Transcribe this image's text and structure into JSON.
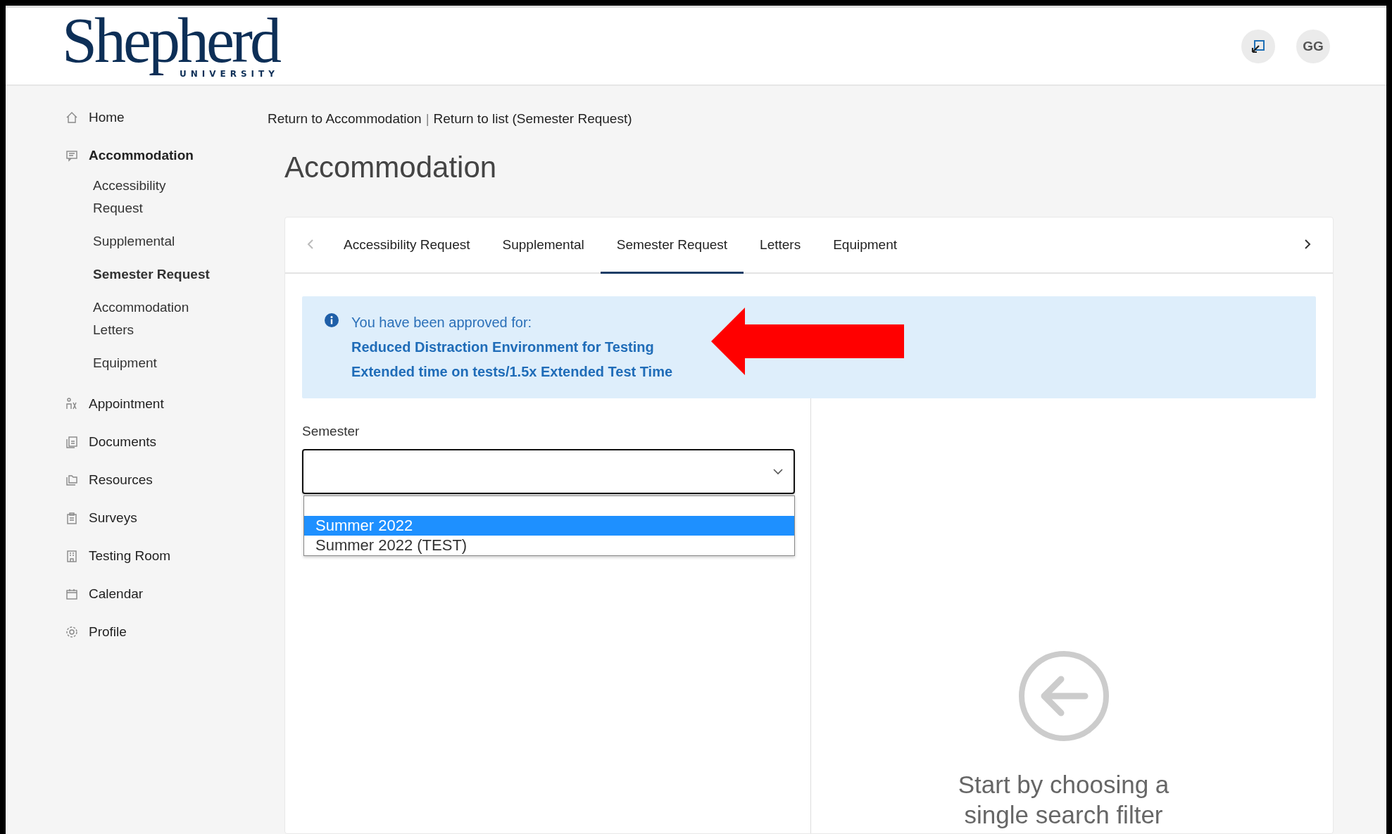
{
  "header": {
    "logo": {
      "name": "Shepherd",
      "subtitle": "UNIVERSITY"
    },
    "avatar": "GG"
  },
  "sidebar": {
    "items": [
      {
        "label": "Home",
        "selected": false
      },
      {
        "label": "Accommodation",
        "selected": true,
        "children": [
          {
            "label": "Accessibility Request",
            "selected": false
          },
          {
            "label": "Supplemental",
            "selected": false
          },
          {
            "label": "Semester Request",
            "selected": true
          },
          {
            "label": "Accommodation Letters",
            "selected": false
          },
          {
            "label": "Equipment",
            "selected": false
          }
        ]
      },
      {
        "label": "Appointment",
        "selected": false
      },
      {
        "label": "Documents",
        "selected": false
      },
      {
        "label": "Resources",
        "selected": false
      },
      {
        "label": "Surveys",
        "selected": false
      },
      {
        "label": "Testing Room",
        "selected": false
      },
      {
        "label": "Calendar",
        "selected": false
      },
      {
        "label": "Profile",
        "selected": false
      }
    ]
  },
  "breadcrumb": {
    "links": [
      "Return to Accommodation",
      "Return to list (Semester Request)"
    ],
    "separator": "|"
  },
  "page_title": "Accommodation",
  "tabs": [
    {
      "label": "Accessibility Request",
      "selected": false
    },
    {
      "label": "Supplemental",
      "selected": false
    },
    {
      "label": "Semester Request",
      "selected": true
    },
    {
      "label": "Letters",
      "selected": false
    },
    {
      "label": "Equipment",
      "selected": false
    }
  ],
  "info": {
    "heading": "You have been approved for:",
    "items": [
      "Reduced Distraction Environment for Testing",
      "Extended time on tests/1.5x Extended Test Time"
    ]
  },
  "semester": {
    "label": "Semester",
    "options": [
      {
        "label": "Summer 2022",
        "selected": true
      },
      {
        "label": "Summer 2022 (TEST)",
        "selected": false
      }
    ]
  },
  "empty_state": {
    "message": "Start by choosing a single search filter"
  }
}
